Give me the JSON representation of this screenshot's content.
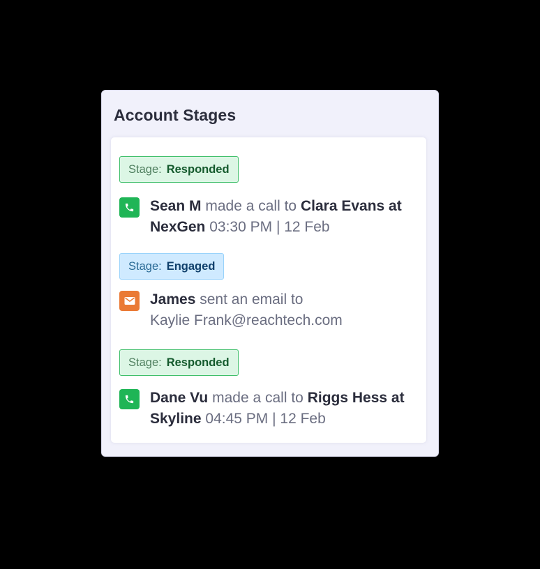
{
  "card": {
    "title": "Account Stages"
  },
  "activities": [
    {
      "stage_label": "Stage:",
      "stage_value": "Responded",
      "stage_color": "#3fbf6a",
      "icon": "phone-icon",
      "actor": "Sean M",
      "action": "made a call to",
      "target": "Clara Evans at NexGen",
      "time": "03:30 PM | 12 Feb"
    },
    {
      "stage_label": "Stage:",
      "stage_value": "Engaged",
      "stage_color": "#9ad3fb",
      "icon": "mail-icon",
      "actor": "James",
      "action": "sent an email to",
      "target": "Kaylie Frank@reachtech.com"
    },
    {
      "stage_label": "Stage:",
      "stage_value": "Responded",
      "stage_color": "#3fbf6a",
      "icon": "phone-icon",
      "actor": "Dane Vu",
      "action": "made a call to",
      "target": "Riggs Hess at Skyline",
      "time": "04:45 PM | 12 Feb"
    }
  ]
}
